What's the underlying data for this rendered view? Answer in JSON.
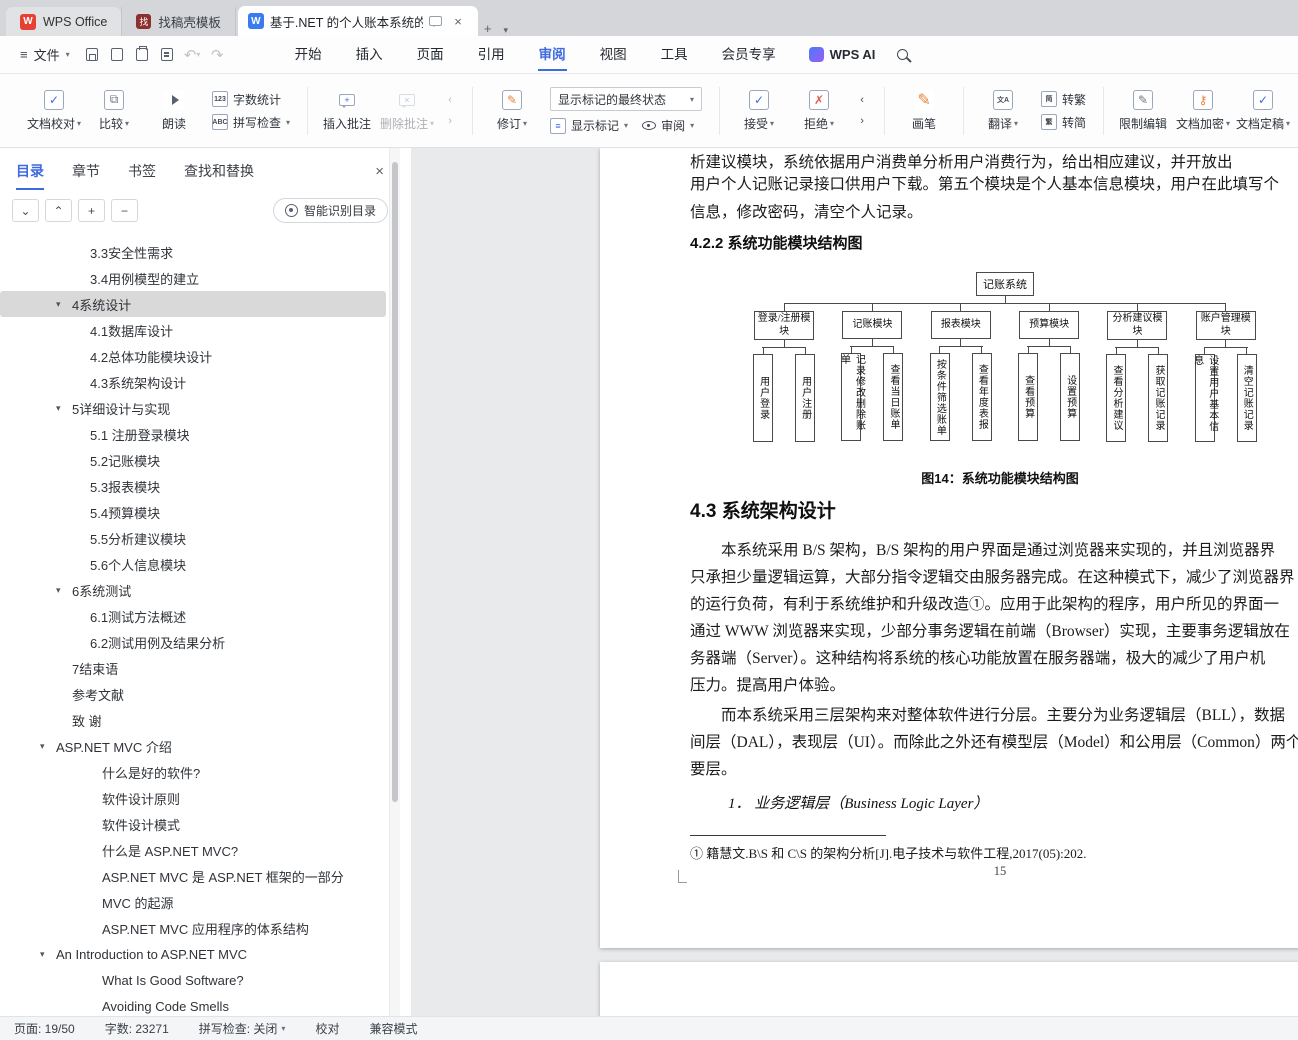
{
  "colors": {
    "accent": "#3e6bdf",
    "tab_bar_bg": "#d4d6d9",
    "doc_bg": "#e9eaec",
    "selection_bg": "#d9d9d9"
  },
  "icons": {
    "hamburger": "≡",
    "undo": "↶",
    "redo": "↷",
    "caret_down": "▾",
    "close": "×",
    "plus": "+",
    "check": "✓",
    "cross": "✗",
    "pen": "✎",
    "prev": "‹",
    "next": "›",
    "wps_logo_letter": "W",
    "doc_logo_letter": "W",
    "template_logo_letter": "找",
    "word_count_badge": "123",
    "spell_badge": "ABC",
    "translate_badge": "文A",
    "to_traditional_badge": "简",
    "to_simplified_badge": "繁",
    "show_markup_badge": "≡"
  },
  "tab_bar": {
    "app_tab_label": "WPS Office",
    "template_tab_label": "找稿壳模板",
    "doc_tab_label": "基于.NET 的个人账本系统的设"
  },
  "menu_bar": {
    "file_label": "文件",
    "items": [
      "开始",
      "插入",
      "页面",
      "引用",
      "审阅",
      "视图",
      "工具",
      "会员专享"
    ],
    "active_item": "审阅",
    "wps_ai_label": "WPS AI"
  },
  "ribbon": {
    "doc_proofread": "文档校对",
    "compare": "比较",
    "read_aloud": "朗读",
    "word_count": "字数统计",
    "spell_check": "拼写检查",
    "insert_comment": "插入批注",
    "delete_comment": "删除批注",
    "revise": "修订",
    "markup_final_state": "显示标记的最终状态",
    "show_markup": "显示标记",
    "review_menu": "审阅",
    "accept": "接受",
    "reject": "拒绝",
    "paint_pen": "画笔",
    "translate": "翻译",
    "to_traditional": "转繁",
    "to_simplified": "转简",
    "restrict_editing": "限制编辑",
    "doc_encrypt": "文档加密",
    "doc_finalize": "文档定稿"
  },
  "sidebar": {
    "tabs": [
      "目录",
      "章节",
      "书签",
      "查找和替换"
    ],
    "active_tab": "目录",
    "smart_toc_button": "智能识别目录",
    "outline": [
      {
        "label": "3.3安全性需求",
        "indent": 2,
        "caret": ""
      },
      {
        "label": "3.4用例模型的建立",
        "indent": 2,
        "caret": ""
      },
      {
        "label": "4系统设计",
        "indent": 1,
        "caret": "▾",
        "selected": true
      },
      {
        "label": "4.1数据库设计",
        "indent": 2,
        "caret": ""
      },
      {
        "label": "4.2总体功能模块设计",
        "indent": 2,
        "caret": ""
      },
      {
        "label": "4.3系统架构设计",
        "indent": 2,
        "caret": ""
      },
      {
        "label": "5详细设计与实现",
        "indent": 1,
        "caret": "▾"
      },
      {
        "label": "5.1 注册登录模块",
        "indent": 2,
        "caret": ""
      },
      {
        "label": "5.2记账模块",
        "indent": 2,
        "caret": ""
      },
      {
        "label": "5.3报表模块",
        "indent": 2,
        "caret": ""
      },
      {
        "label": "5.4预算模块",
        "indent": 2,
        "caret": ""
      },
      {
        "label": "5.5分析建议模块",
        "indent": 2,
        "caret": ""
      },
      {
        "label": "5.6个人信息模块",
        "indent": 2,
        "caret": ""
      },
      {
        "label": "6系统测试",
        "indent": 1,
        "caret": "▾"
      },
      {
        "label": "6.1测试方法概述",
        "indent": 2,
        "caret": ""
      },
      {
        "label": "6.2测试用例及结果分析",
        "indent": 2,
        "caret": ""
      },
      {
        "label": "7结束语",
        "indent": 1,
        "caret": ""
      },
      {
        "label": "参考文献",
        "indent": 1,
        "caret": ""
      },
      {
        "label": "致 谢",
        "indent": 1,
        "caret": ""
      },
      {
        "label": "ASP.NET MVC 介绍",
        "indent": 0,
        "caret": "▾"
      },
      {
        "label": "什么是好的软件?",
        "indent": 3,
        "caret": ""
      },
      {
        "label": "软件设计原则",
        "indent": 3,
        "caret": ""
      },
      {
        "label": "软件设计模式",
        "indent": 3,
        "caret": ""
      },
      {
        "label": "什么是 ASP.NET MVC?",
        "indent": 3,
        "caret": ""
      },
      {
        "label": "ASP.NET MVC 是 ASP.NET 框架的一部分",
        "indent": 3,
        "caret": ""
      },
      {
        "label": "MVC 的起源",
        "indent": 3,
        "caret": ""
      },
      {
        "label": "ASP.NET MVC 应用程序的体系结构",
        "indent": 3,
        "caret": ""
      },
      {
        "label": "An Introduction to ASP.NET MVC",
        "indent": 0,
        "caret": "▾"
      },
      {
        "label": "What Is Good Software?",
        "indent": 3,
        "caret": ""
      },
      {
        "label": "Avoiding Code Smells",
        "indent": 3,
        "caret": ""
      }
    ]
  },
  "document": {
    "para1": [
      "析建议模块，系统依据用户消费单分析用户消费行为，给出相应建议，并开放出",
      "用户个人记账记录接口供用户下载。第五个模块是个人基本信息模块，用户在此填写个",
      "信息，修改密码，清空个人记录。"
    ],
    "heading_422": "4.2.2 系统功能模块结构图",
    "figure_caption": "图14：系统功能模块结构图",
    "heading_43": "4.3 系统架构设计",
    "para2": [
      "　　本系统采用 B/S 架构，B/S 架构的用户界面是通过浏览器来实现的，并且浏览器界",
      "只承担少量逻辑运算，大部分指令逻辑交由服务器完成。在这种模式下，减少了浏览器界",
      "的运行负荷，有利于系统维护和升级改造①。应用于此架构的程序，用户所见的界面一",
      "通过 WWW 浏览器来实现，少部分事务逻辑在前端（Browser）实现，主要事务逻辑放在",
      "务器端（Server）。这种结构将系统的核心功能放置在服务器端，极大的减少了用户机",
      "压力。提高用户体验。"
    ],
    "para3": [
      "　　而本系统采用三层架构来对整体软件进行分层。主要分为业务逻辑层（BLL），数据",
      "间层（DAL），表现层（UI）。而除此之外还有模型层（Model）和公用层（Common）两个",
      "要层。"
    ],
    "list_item_1": "1． 业务逻辑层（Business Logic Layer）",
    "footnote": "① 籍慧文.B\\S 和 C\\S 的架构分析[J].电子技术与软件工程,2017(05):202.",
    "page_number": "15"
  },
  "diagram": {
    "root": "记账系统",
    "modules": [
      {
        "label": "登录/注册模块",
        "leaves": [
          "用户登录",
          "用户注册"
        ]
      },
      {
        "label": "记账模块",
        "leaves": [
          "记录修改删除账单",
          "查看当日账单"
        ]
      },
      {
        "label": "报表模块",
        "leaves": [
          "按条件筛选账单",
          "查看年度表报"
        ]
      },
      {
        "label": "预算模块",
        "leaves": [
          "查看预算",
          "设置预算"
        ]
      },
      {
        "label": "分析建议模块",
        "leaves": [
          "查看分析建议",
          "获取记账记录"
        ]
      },
      {
        "label": "账户管理模块",
        "leaves": [
          "设置用户基本信息",
          "清空记账记录"
        ]
      }
    ]
  },
  "status_bar": {
    "page": "页面: 19/50",
    "words": "字数: 23271",
    "spell": "拼写检查: 关闭",
    "proof": "校对",
    "compat": "兼容模式"
  }
}
